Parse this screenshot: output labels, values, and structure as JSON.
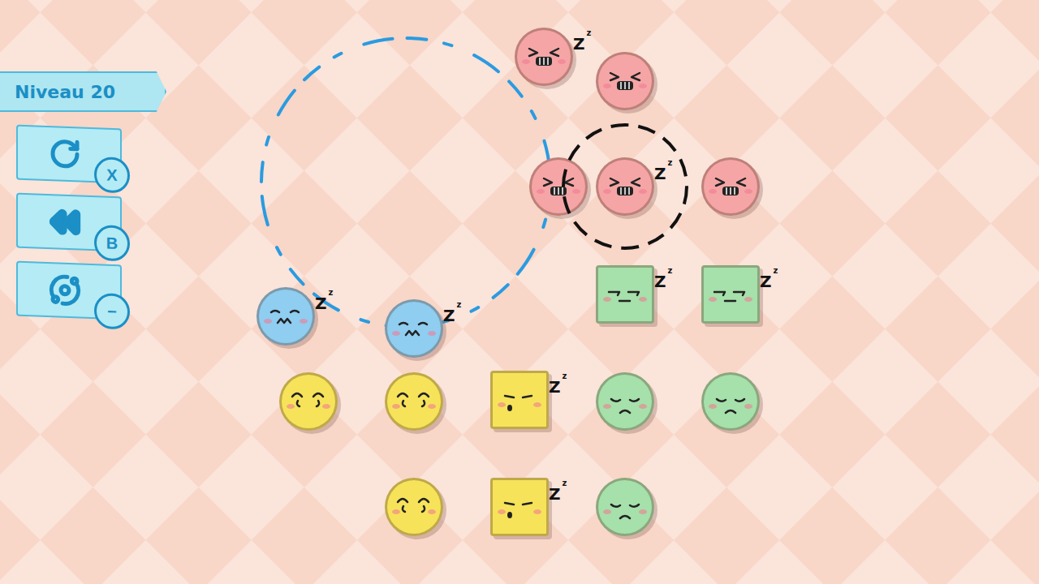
{
  "level": {
    "label": "Niveau 20"
  },
  "menu": [
    {
      "action": "restart",
      "key": "X"
    },
    {
      "action": "undo",
      "key": "B"
    },
    {
      "action": "view",
      "key": "−"
    }
  ],
  "sleep_mark": {
    "big": "Z",
    "small": "z"
  },
  "pieces": [
    {
      "kind": "circle",
      "color": "#f5a5a5",
      "mood": "angry",
      "asleep": true,
      "selected": false
    },
    {
      "kind": "circle",
      "color": "#f5a5a5",
      "mood": "angry",
      "asleep": false,
      "selected": false
    },
    {
      "kind": "circle",
      "color": "#f5a5a5",
      "mood": "angry",
      "asleep": false,
      "selected": false
    },
    {
      "kind": "circle",
      "color": "#f5a5a5",
      "mood": "angry",
      "asleep": true,
      "selected": true
    },
    {
      "kind": "circle",
      "color": "#f5a5a5",
      "mood": "angry",
      "asleep": false,
      "selected": false
    },
    {
      "kind": "square",
      "color": "#a6e0ab",
      "mood": "tired",
      "asleep": true,
      "selected": false
    },
    {
      "kind": "square",
      "color": "#a6e0ab",
      "mood": "tired",
      "asleep": true,
      "selected": false
    },
    {
      "kind": "circle",
      "color": "#8fcdf1",
      "mood": "grumpy",
      "asleep": true,
      "selected": false
    },
    {
      "kind": "circle",
      "color": "#8fcdf1",
      "mood": "grumpy",
      "asleep": true,
      "selected": false
    },
    {
      "kind": "circle",
      "color": "#f6e35a",
      "mood": "content",
      "asleep": false,
      "selected": false
    },
    {
      "kind": "circle",
      "color": "#f6e35a",
      "mood": "content",
      "asleep": false,
      "selected": false
    },
    {
      "kind": "square",
      "color": "#f6e35a",
      "mood": "snoring",
      "asleep": true,
      "selected": false
    },
    {
      "kind": "circle",
      "color": "#a6e0ab",
      "mood": "sad",
      "asleep": false,
      "selected": false
    },
    {
      "kind": "circle",
      "color": "#a6e0ab",
      "mood": "sad",
      "asleep": false,
      "selected": false
    },
    {
      "kind": "circle",
      "color": "#f6e35a",
      "mood": "content",
      "asleep": false,
      "selected": false
    },
    {
      "kind": "square",
      "color": "#f6e35a",
      "mood": "snoring",
      "asleep": true,
      "selected": false
    },
    {
      "kind": "circle",
      "color": "#a6e0ab",
      "mood": "sad",
      "asleep": false,
      "selected": false
    }
  ]
}
